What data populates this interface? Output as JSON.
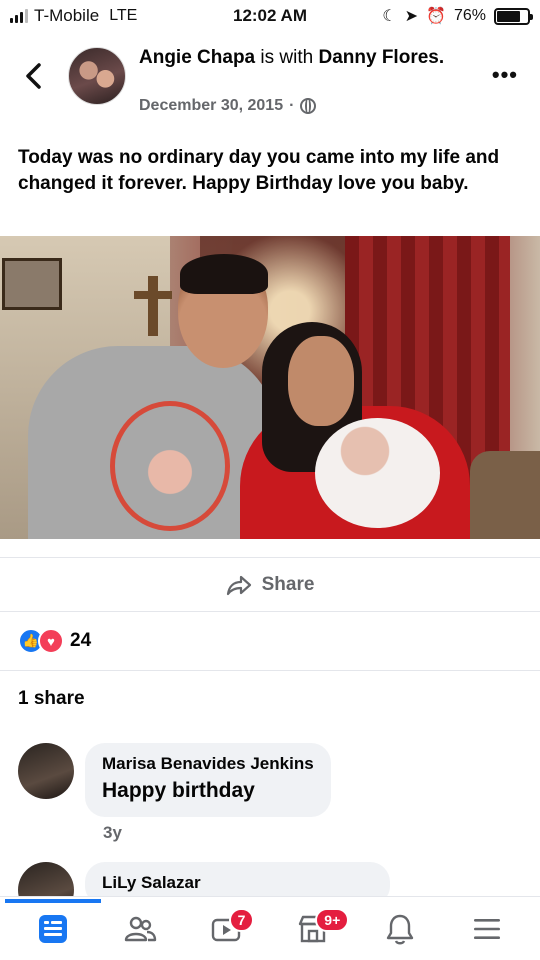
{
  "status_bar": {
    "carrier": "T-Mobile",
    "network": "LTE",
    "time": "12:02 AM",
    "battery": "76%",
    "battery_level": 0.76
  },
  "post": {
    "author": "Angie Chapa",
    "with_text": "is with",
    "tagged": "Danny Flores.",
    "date": "December 30, 2015",
    "privacy_icon": "globe-icon",
    "text": "Today was no ordinary day you came into my life and changed it forever. Happy Birthday love you baby.",
    "share_label": "Share",
    "reaction_count": "24",
    "shares_text": "1 share"
  },
  "comments": [
    {
      "name": "Marisa Benavides Jenkins",
      "text": "Happy birthday",
      "time": "3y"
    },
    {
      "name": "LiLy Salazar",
      "text": "",
      "time": ""
    }
  ],
  "tab_bar": {
    "items": [
      {
        "icon": "feed-icon",
        "badge": ""
      },
      {
        "icon": "friends-icon",
        "badge": ""
      },
      {
        "icon": "watch-icon",
        "badge": "7"
      },
      {
        "icon": "marketplace-icon",
        "badge": "9+"
      },
      {
        "icon": "notifications-icon",
        "badge": ""
      },
      {
        "icon": "menu-icon",
        "badge": ""
      }
    ]
  },
  "colors": {
    "accent": "#1877f2",
    "secondary_text": "#65676b",
    "badge": "#e41e3f",
    "bubble": "#f0f2f5"
  }
}
